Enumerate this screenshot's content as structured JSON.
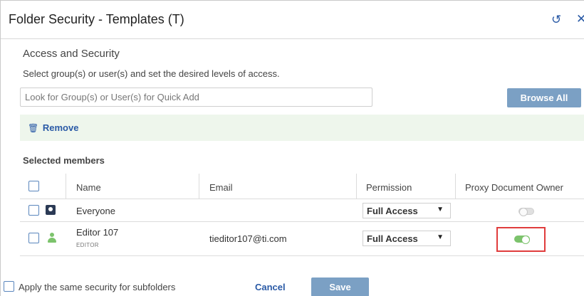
{
  "dialog": {
    "title": "Folder Security - Templates (T)",
    "refresh_icon": "refresh-icon",
    "close_icon": "close-icon"
  },
  "access": {
    "section_title": "Access and Security",
    "instructions": "Select group(s) or user(s) and set the desired levels of access.",
    "search_placeholder": "Look for Group(s) or User(s) for Quick Add",
    "search_value": "",
    "browse_label": "Browse All"
  },
  "actions": {
    "remove_label": "Remove",
    "remove_icon": "trash-icon"
  },
  "members": {
    "title": "Selected members",
    "columns": {
      "name": "Name",
      "email": "Email",
      "permission": "Permission",
      "proxy_owner": "Proxy Document Owner"
    },
    "rows": [
      {
        "type_icon": "group-icon",
        "name": "Everyone",
        "role": "",
        "email": "",
        "permission": "Full Access",
        "proxy_owner": false,
        "selected": false
      },
      {
        "type_icon": "user-icon",
        "name": "Editor 107",
        "role": "EDITOR",
        "email": "tieditor107@ti.com",
        "permission": "Full Access",
        "proxy_owner": true,
        "selected": false
      }
    ]
  },
  "footer": {
    "apply_subfolders_label": "Apply the same security for subfolders",
    "apply_subfolders_checked": false,
    "cancel_label": "Cancel",
    "save_label": "Save"
  },
  "colors": {
    "accent_blue": "#2a5aa6",
    "button_blue": "#7ba0c4",
    "toggle_on": "#7cc36c",
    "highlight_red": "#e03c3c",
    "remove_bar_bg": "#eef6ec"
  }
}
